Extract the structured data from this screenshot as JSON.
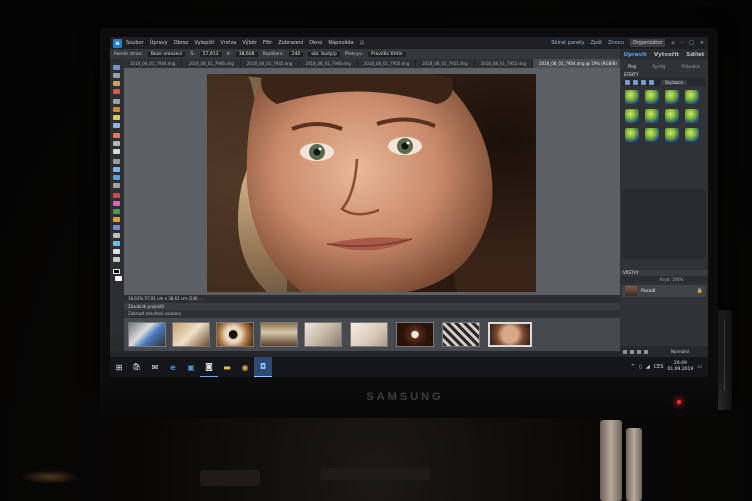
{
  "monitor": {
    "brand": "SAMSUNG"
  },
  "menubar": {
    "app_logo": "e",
    "items": [
      "Soubor",
      "Úpravy",
      "Obraz",
      "Vylepšit",
      "Vrstva",
      "Výběr",
      "Filtr",
      "Zobrazení",
      "Okno",
      "Nápověda"
    ],
    "window_icon": "▤",
    "right": {
      "panels": "Sbírat panely",
      "undo": "Zpět",
      "redo": "Znovu",
      "organizer": "Organizátor",
      "home": "⌂",
      "minimize": "–",
      "maximize": "□",
      "close": "✕"
    }
  },
  "options_bar": {
    "ratio_label": "Poměr stran:",
    "ratio_value": "Beze omezení",
    "width_label": "Š:",
    "width_value": "57,913",
    "height_label": "V:",
    "height_value": "38,608",
    "resolution_label": "Rozlišení:",
    "resolution_value": "240",
    "unit_value": "obr. body/p",
    "overlay_label": "Překryv:",
    "overlay_value": "Pravidlo třetin"
  },
  "tabs": [
    {
      "label": "2018_08_01_7944.dng",
      "active": false
    },
    {
      "label": "2018_08_01_7946.dng",
      "active": false
    },
    {
      "label": "2018_08_01_7945.dng",
      "active": false
    },
    {
      "label": "2018_08_01_7948.dng",
      "active": false
    },
    {
      "label": "2018_08_01_7950.dng",
      "active": false
    },
    {
      "label": "2018_08_01_7951.dng",
      "active": false
    },
    {
      "label": "2018_08_01_7952.dng",
      "active": false
    },
    {
      "label": "2018_08_01_7954.dng @ 19% (RGB/8)",
      "active": true
    }
  ],
  "status_bar": {
    "text": "19,63%    57,91 cm x 38,61 cm (240 ..."
  },
  "bin": {
    "header": "Zásobník projektů",
    "toolbar": "Zobrazit otevřené soubory"
  },
  "right_panel": {
    "tabs": [
      {
        "label": "Upravit",
        "active": true
      },
      {
        "label": "Vytvořit",
        "active": false
      },
      {
        "label": "Sdílet",
        "active": false
      }
    ],
    "subtabs": [
      {
        "label": "Plný",
        "active": true
      },
      {
        "label": "Rychlý",
        "active": false
      },
      {
        "label": "Průvodce",
        "active": false
      }
    ],
    "effects_label": "EFEKTY",
    "effects_dropdown": "Stylizace",
    "layers_label": "VRSTVY",
    "layers_tools": "Krytí: 100%",
    "layer_name": "Pozadí",
    "blend_label": "Normální"
  },
  "taskbar": {
    "start_icon": "⊞",
    "apps": [
      {
        "name": "store",
        "glyph": "🛍",
        "running": false,
        "active": false
      },
      {
        "name": "mail",
        "glyph": "✉",
        "running": false,
        "active": false
      },
      {
        "name": "edge",
        "glyph": "e",
        "running": false,
        "active": false
      },
      {
        "name": "maps",
        "glyph": "▣",
        "running": false,
        "active": false
      },
      {
        "name": "photoshop-elements",
        "glyph": "◙",
        "running": true,
        "active": false
      },
      {
        "name": "explorer",
        "glyph": "▬",
        "running": false,
        "active": false
      },
      {
        "name": "chrome",
        "glyph": "◉",
        "running": false,
        "active": false
      },
      {
        "name": "pse-editor",
        "glyph": "◘",
        "running": true,
        "active": true
      }
    ],
    "tray": {
      "expand": "^",
      "network": "▯",
      "volume": "◢",
      "lang": "CES"
    },
    "clock": {
      "time": "20:49",
      "date": "01.09.2019"
    },
    "notification": "▭"
  },
  "colors": {
    "accent": "#4fa3ff",
    "app_bg": "#2a2b2d",
    "canvas_bg": "#5c5f63",
    "taskbar_active": "#2d4a72"
  }
}
